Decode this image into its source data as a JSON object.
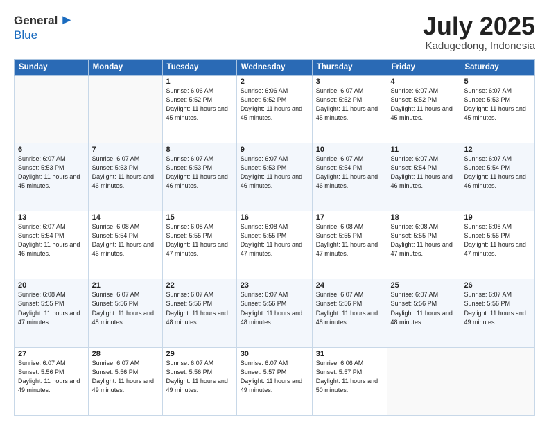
{
  "logo": {
    "general": "General",
    "blue": "Blue"
  },
  "header": {
    "month": "July 2025",
    "location": "Kadugedong, Indonesia"
  },
  "weekdays": [
    "Sunday",
    "Monday",
    "Tuesday",
    "Wednesday",
    "Thursday",
    "Friday",
    "Saturday"
  ],
  "weeks": [
    [
      {
        "day": "",
        "info": ""
      },
      {
        "day": "",
        "info": ""
      },
      {
        "day": "1",
        "info": "Sunrise: 6:06 AM\nSunset: 5:52 PM\nDaylight: 11 hours and 45 minutes."
      },
      {
        "day": "2",
        "info": "Sunrise: 6:06 AM\nSunset: 5:52 PM\nDaylight: 11 hours and 45 minutes."
      },
      {
        "day": "3",
        "info": "Sunrise: 6:07 AM\nSunset: 5:52 PM\nDaylight: 11 hours and 45 minutes."
      },
      {
        "day": "4",
        "info": "Sunrise: 6:07 AM\nSunset: 5:52 PM\nDaylight: 11 hours and 45 minutes."
      },
      {
        "day": "5",
        "info": "Sunrise: 6:07 AM\nSunset: 5:53 PM\nDaylight: 11 hours and 45 minutes."
      }
    ],
    [
      {
        "day": "6",
        "info": "Sunrise: 6:07 AM\nSunset: 5:53 PM\nDaylight: 11 hours and 45 minutes."
      },
      {
        "day": "7",
        "info": "Sunrise: 6:07 AM\nSunset: 5:53 PM\nDaylight: 11 hours and 46 minutes."
      },
      {
        "day": "8",
        "info": "Sunrise: 6:07 AM\nSunset: 5:53 PM\nDaylight: 11 hours and 46 minutes."
      },
      {
        "day": "9",
        "info": "Sunrise: 6:07 AM\nSunset: 5:53 PM\nDaylight: 11 hours and 46 minutes."
      },
      {
        "day": "10",
        "info": "Sunrise: 6:07 AM\nSunset: 5:54 PM\nDaylight: 11 hours and 46 minutes."
      },
      {
        "day": "11",
        "info": "Sunrise: 6:07 AM\nSunset: 5:54 PM\nDaylight: 11 hours and 46 minutes."
      },
      {
        "day": "12",
        "info": "Sunrise: 6:07 AM\nSunset: 5:54 PM\nDaylight: 11 hours and 46 minutes."
      }
    ],
    [
      {
        "day": "13",
        "info": "Sunrise: 6:07 AM\nSunset: 5:54 PM\nDaylight: 11 hours and 46 minutes."
      },
      {
        "day": "14",
        "info": "Sunrise: 6:08 AM\nSunset: 5:54 PM\nDaylight: 11 hours and 46 minutes."
      },
      {
        "day": "15",
        "info": "Sunrise: 6:08 AM\nSunset: 5:55 PM\nDaylight: 11 hours and 47 minutes."
      },
      {
        "day": "16",
        "info": "Sunrise: 6:08 AM\nSunset: 5:55 PM\nDaylight: 11 hours and 47 minutes."
      },
      {
        "day": "17",
        "info": "Sunrise: 6:08 AM\nSunset: 5:55 PM\nDaylight: 11 hours and 47 minutes."
      },
      {
        "day": "18",
        "info": "Sunrise: 6:08 AM\nSunset: 5:55 PM\nDaylight: 11 hours and 47 minutes."
      },
      {
        "day": "19",
        "info": "Sunrise: 6:08 AM\nSunset: 5:55 PM\nDaylight: 11 hours and 47 minutes."
      }
    ],
    [
      {
        "day": "20",
        "info": "Sunrise: 6:08 AM\nSunset: 5:55 PM\nDaylight: 11 hours and 47 minutes."
      },
      {
        "day": "21",
        "info": "Sunrise: 6:07 AM\nSunset: 5:56 PM\nDaylight: 11 hours and 48 minutes."
      },
      {
        "day": "22",
        "info": "Sunrise: 6:07 AM\nSunset: 5:56 PM\nDaylight: 11 hours and 48 minutes."
      },
      {
        "day": "23",
        "info": "Sunrise: 6:07 AM\nSunset: 5:56 PM\nDaylight: 11 hours and 48 minutes."
      },
      {
        "day": "24",
        "info": "Sunrise: 6:07 AM\nSunset: 5:56 PM\nDaylight: 11 hours and 48 minutes."
      },
      {
        "day": "25",
        "info": "Sunrise: 6:07 AM\nSunset: 5:56 PM\nDaylight: 11 hours and 48 minutes."
      },
      {
        "day": "26",
        "info": "Sunrise: 6:07 AM\nSunset: 5:56 PM\nDaylight: 11 hours and 49 minutes."
      }
    ],
    [
      {
        "day": "27",
        "info": "Sunrise: 6:07 AM\nSunset: 5:56 PM\nDaylight: 11 hours and 49 minutes."
      },
      {
        "day": "28",
        "info": "Sunrise: 6:07 AM\nSunset: 5:56 PM\nDaylight: 11 hours and 49 minutes."
      },
      {
        "day": "29",
        "info": "Sunrise: 6:07 AM\nSunset: 5:56 PM\nDaylight: 11 hours and 49 minutes."
      },
      {
        "day": "30",
        "info": "Sunrise: 6:07 AM\nSunset: 5:57 PM\nDaylight: 11 hours and 49 minutes."
      },
      {
        "day": "31",
        "info": "Sunrise: 6:06 AM\nSunset: 5:57 PM\nDaylight: 11 hours and 50 minutes."
      },
      {
        "day": "",
        "info": ""
      },
      {
        "day": "",
        "info": ""
      }
    ]
  ]
}
